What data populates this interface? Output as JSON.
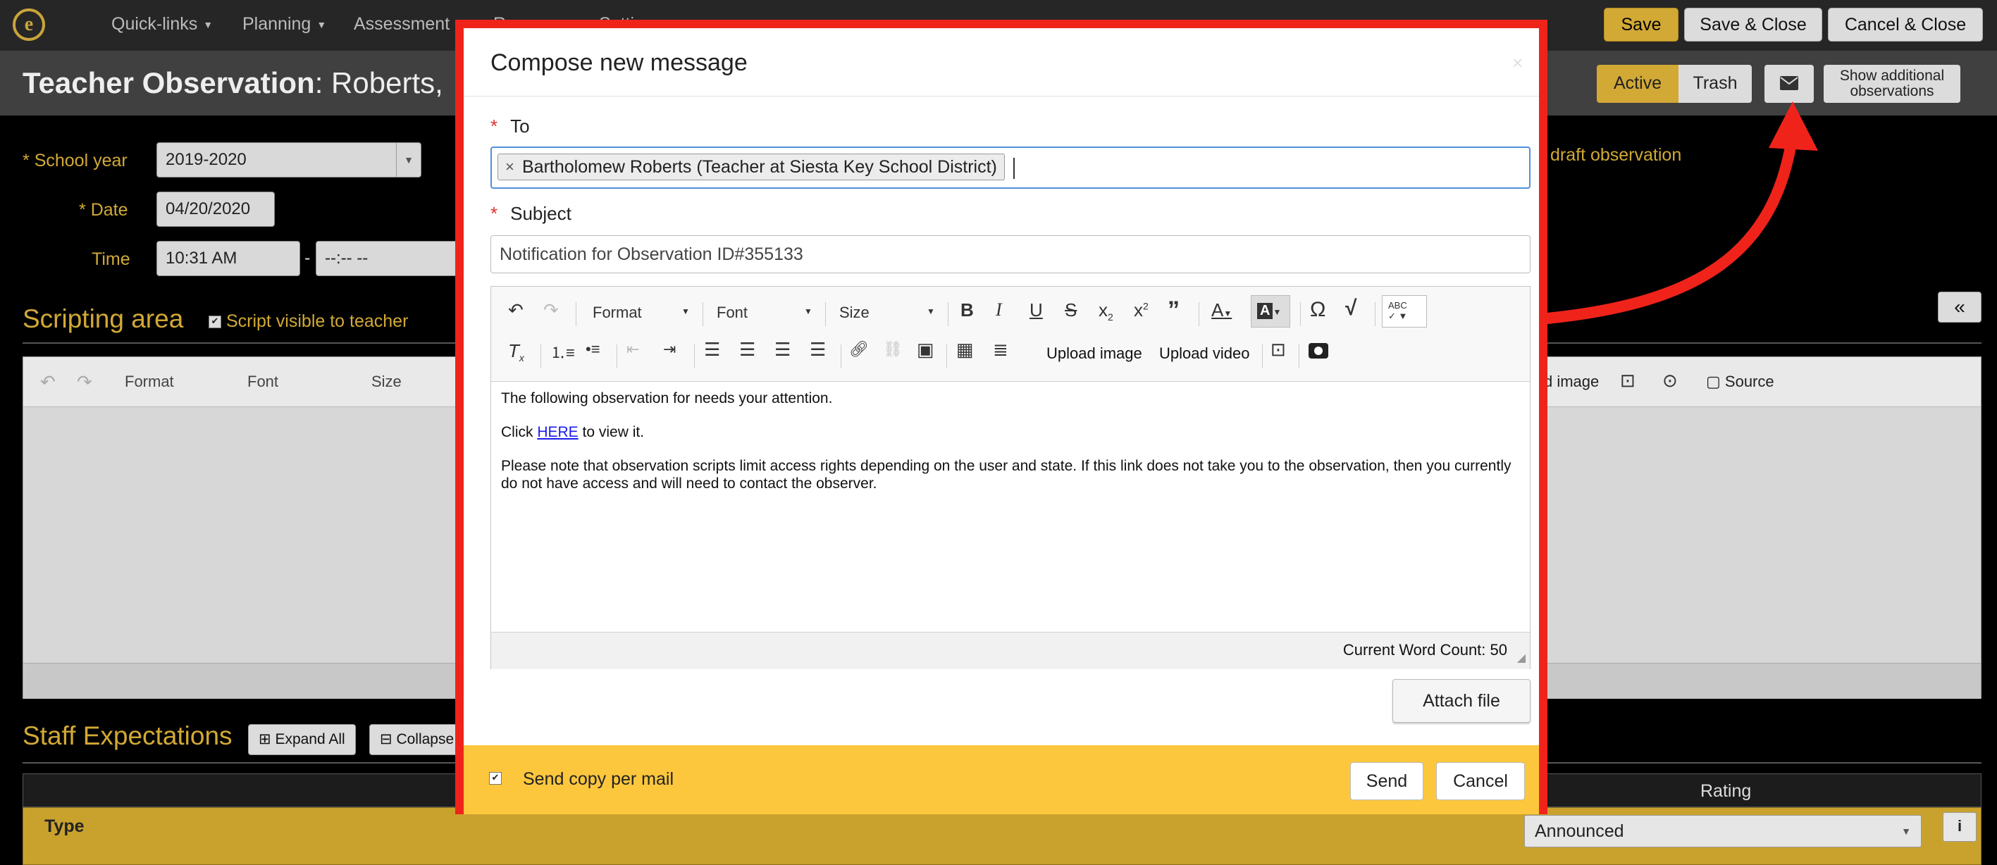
{
  "nav": {
    "items": [
      "Quick-links",
      "Planning",
      "Assessment",
      "R",
      "Setti"
    ],
    "save": "Save",
    "save_close": "Save & Close",
    "cancel_close": "Cancel & Close"
  },
  "header": {
    "title_bold": "Teacher Observation",
    "title_rest": ": Roberts,",
    "active": "Active",
    "trash": "Trash",
    "show_additional": "Show additional observations"
  },
  "form": {
    "school_year_label": "School year",
    "school_year": "2019-2020",
    "date_label": "Date",
    "date": "04/20/2020",
    "time_label": "Time",
    "time_start": "10:31 AM",
    "time_dash": "-",
    "time_end": "--:-- --",
    "draft_note": "draft observation"
  },
  "scripting": {
    "title": "Scripting area",
    "visible_label": "Script visible to teacher",
    "toolbar": {
      "format": "Format",
      "font": "Font",
      "size": "Size",
      "upload": "d image",
      "source": "Source"
    },
    "collapse_glyph": "«"
  },
  "staff": {
    "title": "Staff Expectations",
    "expand_all": "Expand All",
    "collapse": "Collapse",
    "rating_header": "Rating",
    "type_label": "Type",
    "type_value": "Announced"
  },
  "modal": {
    "title": "Compose new message",
    "close_glyph": "×",
    "to_label": "To",
    "recipient": "Bartholomew Roberts (Teacher at Siesta Key School District)",
    "subject_label": "Subject",
    "subject_value": "Notification for Observation ID#355133",
    "toolbar": {
      "format": "Format",
      "font": "Font",
      "size": "Size",
      "upload_image": "Upload image",
      "upload_video": "Upload video"
    },
    "body": {
      "line1": "The following observation for needs your attention.",
      "click": "Click",
      "here": "HERE",
      "to_view": "to view it.",
      "note": "Please note that observation scripts limit access rights depending on the user and state. If this link does not take you to the observation, then you currently do not have access and will need to contact the observer."
    },
    "word_count": "Current Word Count: 50",
    "attach_file": "Attach file",
    "send_copy_label": "Send copy per mail",
    "send": "Send",
    "cancel": "Cancel"
  },
  "colors": {
    "accent_gold": "#d2a935",
    "highlight_red": "#f0231b",
    "footer_yellow": "#fcc73d"
  }
}
